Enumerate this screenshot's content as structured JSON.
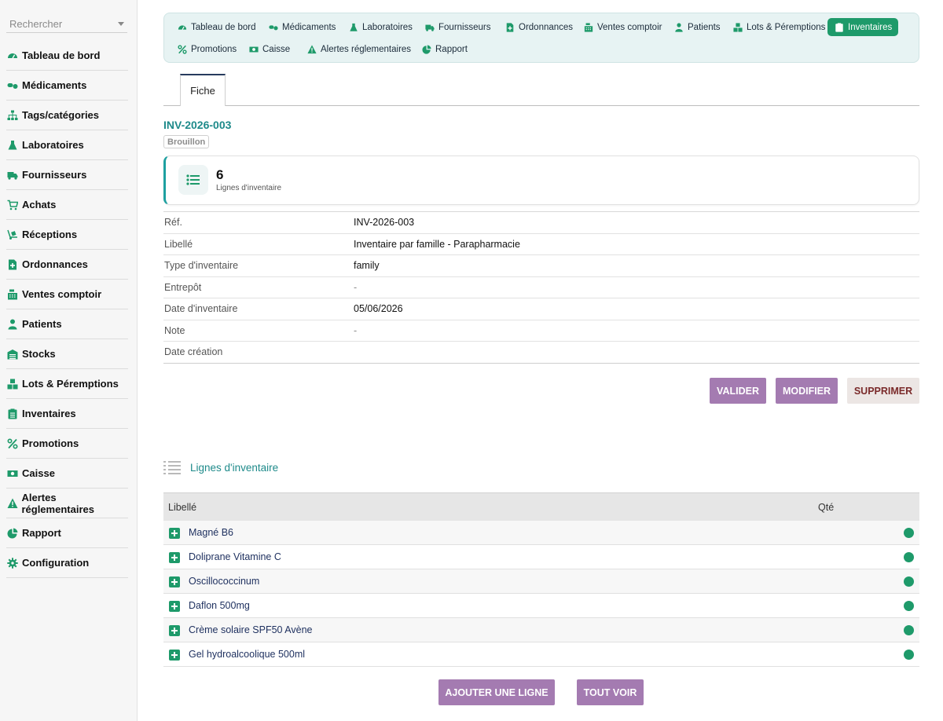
{
  "sidebar": {
    "search_placeholder": "Rechercher",
    "items": [
      {
        "label": "Tableau de bord",
        "icon": "dashboard-icon"
      },
      {
        "label": "Médicaments",
        "icon": "pills-icon"
      },
      {
        "label": "Tags/catégories",
        "icon": "sitemap-icon"
      },
      {
        "label": "Laboratoires",
        "icon": "flask-icon"
      },
      {
        "label": "Fournisseurs",
        "icon": "truck-icon"
      },
      {
        "label": "Achats",
        "icon": "cart-icon"
      },
      {
        "label": "Réceptions",
        "icon": "dolly-icon"
      },
      {
        "label": "Ordonnances",
        "icon": "prescription-icon"
      },
      {
        "label": "Ventes comptoir",
        "icon": "cash-register-icon"
      },
      {
        "label": "Patients",
        "icon": "user-icon"
      },
      {
        "label": "Stocks",
        "icon": "warehouse-icon"
      },
      {
        "label": "Lots & Péremptions",
        "icon": "boxes-icon"
      },
      {
        "label": "Inventaires",
        "icon": "clipboard-icon"
      },
      {
        "label": "Promotions",
        "icon": "percent-icon"
      },
      {
        "label": "Caisse",
        "icon": "money-icon"
      },
      {
        "label": "Alertes réglementaires",
        "icon": "warning-icon"
      },
      {
        "label": "Rapport",
        "icon": "pie-chart-icon"
      },
      {
        "label": "Configuration",
        "icon": "gear-icon"
      }
    ]
  },
  "topnav": {
    "items": [
      {
        "label": "Tableau de bord",
        "icon": "dashboard-icon",
        "active": false
      },
      {
        "label": "Médicaments",
        "icon": "pills-icon",
        "active": false
      },
      {
        "label": "Laboratoires",
        "icon": "flask-icon",
        "active": false
      },
      {
        "label": "Fournisseurs",
        "icon": "truck-icon",
        "active": false
      },
      {
        "label": "Ordonnances",
        "icon": "prescription-icon",
        "active": false
      },
      {
        "label": "Ventes comptoir",
        "icon": "cash-register-icon",
        "active": false
      },
      {
        "label": "Patients",
        "icon": "user-icon",
        "active": false
      },
      {
        "label": "Lots & Péremptions",
        "icon": "boxes-icon",
        "active": false
      },
      {
        "label": "Inventaires",
        "icon": "clipboard-icon",
        "active": true
      },
      {
        "label": "Promotions",
        "icon": "percent-icon",
        "active": false
      },
      {
        "label": "Caisse",
        "icon": "money-icon",
        "active": false
      },
      {
        "label": "Alertes réglementaires",
        "icon": "warning-icon",
        "active": false
      },
      {
        "label": "Rapport",
        "icon": "pie-chart-icon",
        "active": false
      }
    ]
  },
  "tabs": {
    "fiche": "Fiche"
  },
  "record": {
    "title": "INV-2026-003",
    "status": "Brouillon"
  },
  "stat": {
    "value": "6",
    "label": "Lignes d'inventaire",
    "icon": "list-icon"
  },
  "details": [
    {
      "label": "Réf.",
      "value": "INV-2026-003"
    },
    {
      "label": "Libellé",
      "value": "Inventaire par famille - Parapharmacie"
    },
    {
      "label": "Type d'inventaire",
      "value": "family"
    },
    {
      "label": "Entrepôt",
      "value": "-"
    },
    {
      "label": "Date d'inventaire",
      "value": "05/06/2026"
    },
    {
      "label": "Note",
      "value": "-"
    },
    {
      "label": "Date création",
      "value": ""
    }
  ],
  "actions": {
    "validate": "VALIDER",
    "edit": "MODIFIER",
    "delete": "SUPPRIMER"
  },
  "lines_section": {
    "title": "Lignes d'inventaire",
    "col_label": "Libellé",
    "col_qty": "Qté",
    "rows": [
      "Magné B6",
      "Doliprane Vitamine C",
      "Oscillococcinum",
      "Daflon 500mg",
      "Crème solaire SPF50 Avène",
      "Gel hydroalcoolique 500ml"
    ],
    "add_line": "AJOUTER UNE LIGNE",
    "see_all": "TOUT VOIR"
  },
  "colors": {
    "accent_green": "#1e9a6a",
    "teal_title": "#1e8a8a",
    "button_purple": "#a47bb1",
    "nav_bg": "#e7f3f3"
  }
}
